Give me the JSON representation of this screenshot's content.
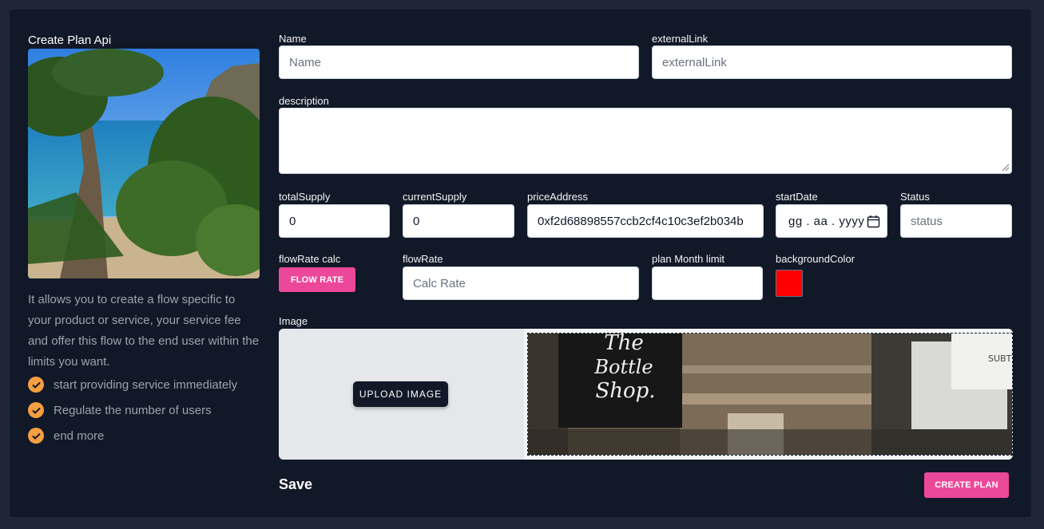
{
  "left": {
    "title": "Create Plan Api",
    "description": "It allows you to create a flow specific to your product or service, your service fee and offer this flow to the end user within the limits you want.",
    "features": [
      "start providing service immediately",
      "Regulate the number of users",
      "end more"
    ]
  },
  "form": {
    "name": {
      "label": "Name",
      "placeholder": "Name",
      "value": ""
    },
    "externalLink": {
      "label": "externalLink",
      "placeholder": "externalLink",
      "value": ""
    },
    "description": {
      "label": "description",
      "value": ""
    },
    "totalSupply": {
      "label": "totalSupply",
      "value": "0"
    },
    "currentSupply": {
      "label": "currentSupply",
      "value": "0"
    },
    "priceAddress": {
      "label": "priceAddress",
      "value": "0xf2d68898557ccb2cf4c10c3ef2b034b"
    },
    "startDate": {
      "label": "startDate",
      "placeholder": "gg . aa . yyyy"
    },
    "status": {
      "label": "Status",
      "placeholder": "status",
      "value": ""
    },
    "flowRateCalc": {
      "label": "flowRate calc",
      "button": "FLOW RATE"
    },
    "flowRate": {
      "label": "flowRate",
      "placeholder": "Calc Rate",
      "value": ""
    },
    "planMonthLimit": {
      "label": "plan Month limit",
      "value": ""
    },
    "backgroundColor": {
      "label": "backgroundColor",
      "value": "#ff0000"
    },
    "image": {
      "label": "Image",
      "upload_button": "UPLOAD IMAGE",
      "preview_text": [
        "The",
        "Bottle",
        "Shop."
      ],
      "preview_side_text": "SUBT"
    }
  },
  "footer": {
    "save": "Save",
    "create_plan": "CREATE PLAN"
  },
  "colors": {
    "accent": "#ec4899",
    "check": "#f59e42",
    "background": "#111827"
  }
}
